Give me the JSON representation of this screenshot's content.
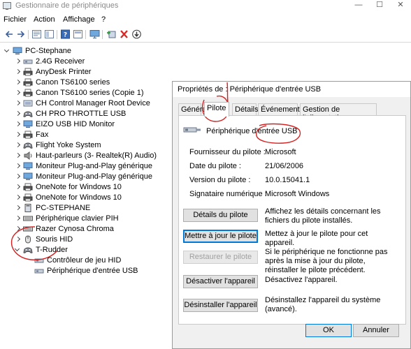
{
  "window": {
    "title": "Gestionnaire de périphériques",
    "controls": [
      "—",
      "☐",
      "✕"
    ]
  },
  "menu": [
    "Fichier",
    "Action",
    "Affichage",
    "?"
  ],
  "toolbar": {
    "icons": [
      "back-arrow-icon",
      "forward-arrow-icon",
      "properties-icon",
      "show-hide-tree-icon",
      "help-icon",
      "view-icon",
      "monitor-icon",
      "add-driver-icon",
      "uninstall-icon",
      "download-icon"
    ]
  },
  "tree": {
    "root": "PC-Stephane",
    "items": [
      {
        "label": "2.4G Receiver",
        "icon": "hid-icon"
      },
      {
        "label": "AnyDesk Printer",
        "icon": "printer-icon"
      },
      {
        "label": "Canon TS6100 series",
        "icon": "printer-icon"
      },
      {
        "label": "Canon TS6100 series (Copie 1)",
        "icon": "printer-icon"
      },
      {
        "label": "CH Control Manager Root Device",
        "icon": "device-icon"
      },
      {
        "label": "CH PRO THROTTLE USB",
        "icon": "gamepad-icon"
      },
      {
        "label": "EIZO USB HID Monitor",
        "icon": "monitor-icon"
      },
      {
        "label": "Fax",
        "icon": "printer-icon"
      },
      {
        "label": "Flight Yoke System",
        "icon": "gamepad-icon"
      },
      {
        "label": "Haut-parleurs (3- Realtek(R) Audio)",
        "icon": "speaker-icon"
      },
      {
        "label": "Moniteur Plug-and-Play générique",
        "icon": "monitor-icon"
      },
      {
        "label": "Moniteur Plug-and-Play générique",
        "icon": "monitor-icon"
      },
      {
        "label": "OneNote for Windows 10",
        "icon": "printer-icon"
      },
      {
        "label": "OneNote for Windows 10",
        "icon": "printer-icon"
      },
      {
        "label": "PC-STEPHANE",
        "icon": "computer-icon"
      },
      {
        "label": "Périphérique clavier PIH",
        "icon": "keyboard-icon"
      },
      {
        "label": "Razer Cynosa Chroma",
        "icon": "keyboard-icon"
      },
      {
        "label": "Souris HID",
        "icon": "mouse-icon"
      },
      {
        "label": "T-Rudder",
        "icon": "gamepad-icon",
        "expanded": true
      }
    ],
    "children": [
      {
        "label": "Contrôleur de jeu HID",
        "icon": "hid-icon"
      },
      {
        "label": "Périphérique d'entrée USB",
        "icon": "hid-icon"
      }
    ]
  },
  "dialog": {
    "title": "Propriétés de : Périphérique d'entrée USB",
    "tabs": [
      "Général",
      "Pilote",
      "Détails",
      "Événements",
      "Gestion de l'alimentation"
    ],
    "active_tab": "Pilote",
    "device_name": "Périphérique d'entrée USB",
    "fields": [
      {
        "label": "Fournisseur du pilote :",
        "value": "Microsoft"
      },
      {
        "label": "Date du pilote :",
        "value": "21/06/2006"
      },
      {
        "label": "Version du pilote :",
        "value": "10.0.15041.1"
      },
      {
        "label": "Signataire numérique :",
        "value": "Microsoft Windows"
      }
    ],
    "actions": [
      {
        "button": "Détails du pilote",
        "desc": "Affichez les détails concernant les fichiers du pilote installés."
      },
      {
        "button": "Mettre à jour le pilote",
        "desc": "Mettez à jour le pilote pour cet appareil."
      },
      {
        "button": "Restaurer le pilote",
        "desc": "Si le périphérique ne fonctionne pas après la mise à jour du pilote, réinstaller le pilote précédent."
      },
      {
        "button": "Désactiver l'appareil",
        "desc": "Désactivez l'appareil."
      },
      {
        "button": "Désinstaller l'appareil",
        "desc": "Désinstallez l'appareil du système (avancé)."
      }
    ],
    "ok": "OK",
    "cancel": "Annuler"
  },
  "colors": {
    "annotation": "#d42020",
    "focus": "#0078d7",
    "toolbar_red": "#d62a2a",
    "toolbar_green": "#2a9b3a"
  }
}
